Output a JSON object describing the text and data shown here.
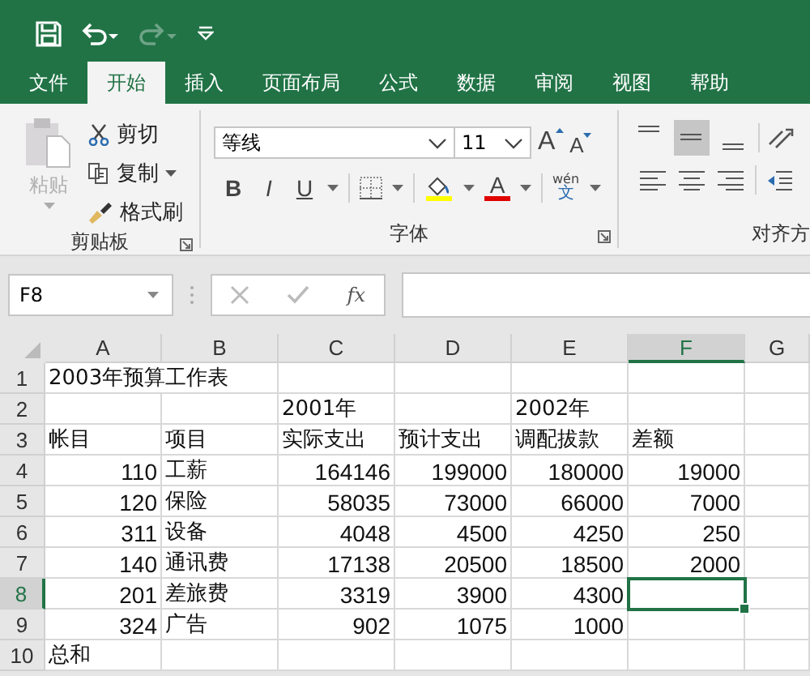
{
  "tabs": [
    {
      "label": "文件",
      "selected": false
    },
    {
      "label": "开始",
      "selected": true
    },
    {
      "label": "插入",
      "selected": false
    },
    {
      "label": "页面布局",
      "selected": false
    },
    {
      "label": "公式",
      "selected": false
    },
    {
      "label": "数据",
      "selected": false
    },
    {
      "label": "审阅",
      "selected": false
    },
    {
      "label": "视图",
      "selected": false
    },
    {
      "label": "帮助",
      "selected": false
    }
  ],
  "quick_access": {
    "redo_disabled": true
  },
  "clipboard": {
    "label": "剪贴板",
    "paste": {
      "label": "粘贴",
      "disabled": true
    },
    "commands": [
      "剪切",
      "复制",
      "格式刷"
    ]
  },
  "font": {
    "label": "字体",
    "font_name": "等线",
    "font_size": "11",
    "grow": "A",
    "shrink": "A",
    "bold": "B",
    "italic": "I",
    "underline": "U",
    "font_color": "A",
    "phonetic_top": "wén",
    "phonetic_bottom": "文"
  },
  "alignment": {
    "label": "对齐方",
    "middle_selected": true
  },
  "formula_bar": {
    "name_box": "F8",
    "fx": "fx"
  },
  "sheet": {
    "columns": [
      {
        "label": "A",
        "selected": false
      },
      {
        "label": "B",
        "selected": false
      },
      {
        "label": "C",
        "selected": false
      },
      {
        "label": "D",
        "selected": false
      },
      {
        "label": "E",
        "selected": false
      },
      {
        "label": "F",
        "selected": true
      },
      {
        "label": "G",
        "selected": false
      }
    ],
    "rows": [
      {
        "label": "1",
        "selected": false,
        "cells": {
          "A": {
            "text": "2003年预算工作表",
            "kind": "text"
          }
        }
      },
      {
        "label": "2",
        "selected": false,
        "cells": {
          "C": {
            "text": "2001年",
            "kind": "text"
          },
          "E": {
            "text": "2002年",
            "kind": "text"
          }
        }
      },
      {
        "label": "3",
        "selected": false,
        "cells": {
          "A": {
            "text": "帐目",
            "kind": "text"
          },
          "B": {
            "text": "项目",
            "kind": "text"
          },
          "C": {
            "text": "实际支出",
            "kind": "text"
          },
          "D": {
            "text": "预计支出",
            "kind": "text"
          },
          "E": {
            "text": "调配拔款",
            "kind": "text"
          },
          "F": {
            "text": "差额",
            "kind": "text"
          }
        }
      },
      {
        "label": "4",
        "selected": false,
        "cells": {
          "A": {
            "text": "110",
            "kind": "number"
          },
          "B": {
            "text": "工薪",
            "kind": "text"
          },
          "C": {
            "text": "164146",
            "kind": "number"
          },
          "D": {
            "text": "199000",
            "kind": "number"
          },
          "E": {
            "text": "180000",
            "kind": "number"
          },
          "F": {
            "text": "19000",
            "kind": "number"
          }
        }
      },
      {
        "label": "5",
        "selected": false,
        "cells": {
          "A": {
            "text": "120",
            "kind": "number"
          },
          "B": {
            "text": "保险",
            "kind": "text"
          },
          "C": {
            "text": "58035",
            "kind": "number"
          },
          "D": {
            "text": "73000",
            "kind": "number"
          },
          "E": {
            "text": "66000",
            "kind": "number"
          },
          "F": {
            "text": "7000",
            "kind": "number"
          }
        }
      },
      {
        "label": "6",
        "selected": false,
        "cells": {
          "A": {
            "text": "311",
            "kind": "number"
          },
          "B": {
            "text": "设备",
            "kind": "text"
          },
          "C": {
            "text": "4048",
            "kind": "number"
          },
          "D": {
            "text": "4500",
            "kind": "number"
          },
          "E": {
            "text": "4250",
            "kind": "number"
          },
          "F": {
            "text": "250",
            "kind": "number"
          }
        }
      },
      {
        "label": "7",
        "selected": false,
        "cells": {
          "A": {
            "text": "140",
            "kind": "number"
          },
          "B": {
            "text": "通讯费",
            "kind": "text"
          },
          "C": {
            "text": "17138",
            "kind": "number"
          },
          "D": {
            "text": "20500",
            "kind": "number"
          },
          "E": {
            "text": "18500",
            "kind": "number"
          },
          "F": {
            "text": "2000",
            "kind": "number"
          }
        }
      },
      {
        "label": "8",
        "selected": true,
        "cells": {
          "A": {
            "text": "201",
            "kind": "number"
          },
          "B": {
            "text": "差旅费",
            "kind": "text"
          },
          "C": {
            "text": "3319",
            "kind": "number"
          },
          "D": {
            "text": "3900",
            "kind": "number"
          },
          "E": {
            "text": "4300",
            "kind": "number"
          },
          "F": {
            "selected": true,
            "kind": "number"
          }
        }
      },
      {
        "label": "9",
        "selected": false,
        "cells": {
          "A": {
            "text": "324",
            "kind": "number"
          },
          "B": {
            "text": "广告",
            "kind": "text"
          },
          "C": {
            "text": "902",
            "kind": "number"
          },
          "D": {
            "text": "1075",
            "kind": "number"
          },
          "E": {
            "text": "1000",
            "kind": "number"
          }
        }
      },
      {
        "label": "10",
        "selected": false,
        "cells": {
          "A": {
            "text": "总和",
            "kind": "text"
          }
        }
      }
    ]
  }
}
